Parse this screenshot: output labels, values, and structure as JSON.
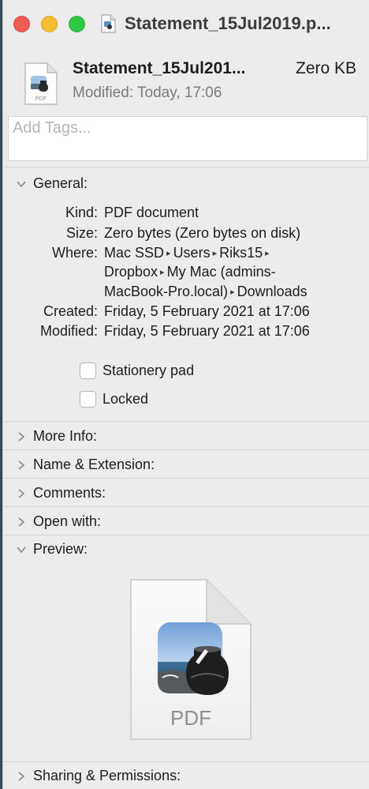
{
  "window": {
    "title": "Statement_15Jul2019.p..."
  },
  "header": {
    "file_name": "Statement_15Jul201...",
    "file_size": "Zero KB",
    "modified_label": "Modified:",
    "modified_value": "Today, 17:06",
    "icon_label": "PDF"
  },
  "tags": {
    "placeholder": "Add Tags..."
  },
  "general": {
    "label": "General:",
    "kind_label": "Kind:",
    "kind_value": "PDF document",
    "size_label": "Size:",
    "size_value": "Zero bytes (Zero bytes on disk)",
    "where_label": "Where:",
    "where_path": [
      "Mac SSD",
      "Users",
      "Riks15",
      "Dropbox",
      "My Mac (admins-",
      "MacBook-Pro.local)",
      "Downloads"
    ],
    "created_label": "Created:",
    "created_value": "Friday, 5 February 2021 at 17:06",
    "modified_label": "Modified:",
    "modified_value": "Friday, 5 February 2021 at 17:06",
    "stationery_label": "Stationery pad",
    "locked_label": "Locked",
    "stationery_checked": false,
    "locked_checked": false
  },
  "sections": {
    "more_info": "More Info:",
    "name_extension": "Name & Extension:",
    "comments": "Comments:",
    "open_with": "Open with:",
    "preview": "Preview:",
    "sharing": "Sharing & Permissions:"
  },
  "preview": {
    "label": "PDF"
  },
  "icons": {
    "document": "pdf-document-icon",
    "chevron_down": "chevron-down-icon",
    "chevron_right": "chevron-right-icon"
  }
}
